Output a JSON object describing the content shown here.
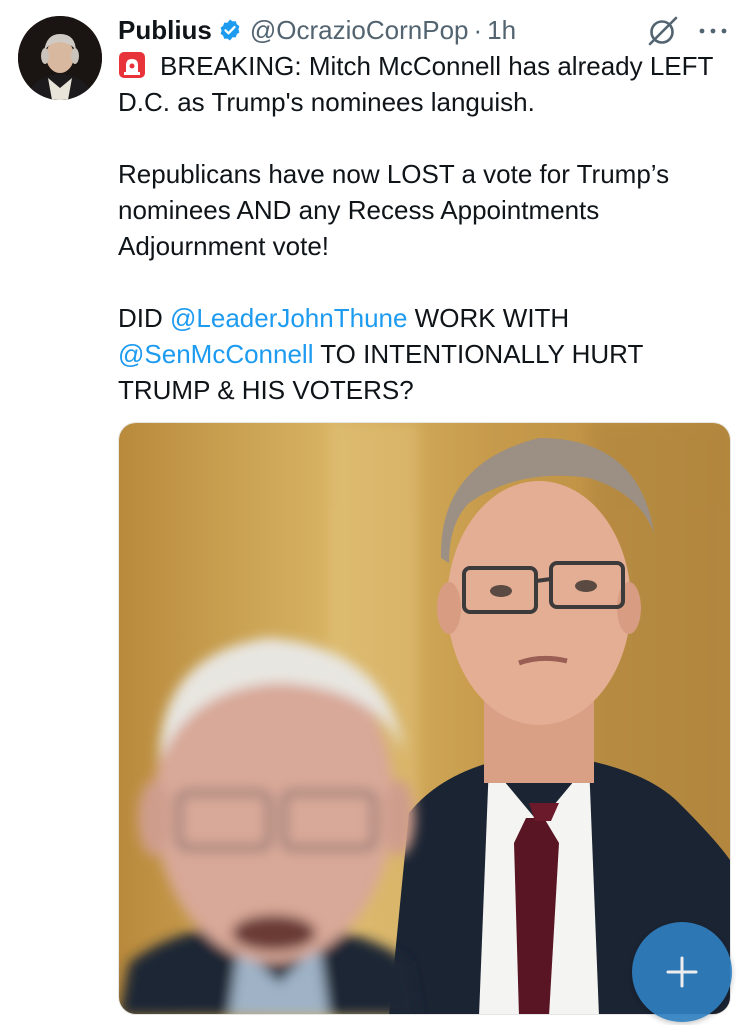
{
  "author": {
    "display_name": "Publius",
    "handle": "@OcrazioCornPop",
    "separator": "·",
    "time": "1h",
    "verified": true,
    "avatar_icon": "founding-father-portrait"
  },
  "tweet": {
    "line1_text": "BREAKING: Mitch McConnell has already LEFT D.C. as Trump's nominees languish.",
    "line1_emoji": "siren-emoji",
    "para2": "Republicans have now LOST a vote for Trump’s nominees AND any Recess Appointments Adjournment vote!",
    "para3_part1": "DID ",
    "para3_mention1": "@LeaderJohnThune",
    "para3_part2": " WORK WITH ",
    "para3_mention2": "@SenMcConnell",
    "para3_part3": " TO INTENTIONALLY HURT TRUMP & HIS VOTERS?"
  },
  "actions": {
    "grok_icon": "grok-icon",
    "more_icon": "more-dots-icon",
    "compose_icon": "plus-icon"
  },
  "colors": {
    "mention": "#1d9bf0",
    "verified": "#1d9bf0",
    "fab": "#2f7fbf"
  }
}
